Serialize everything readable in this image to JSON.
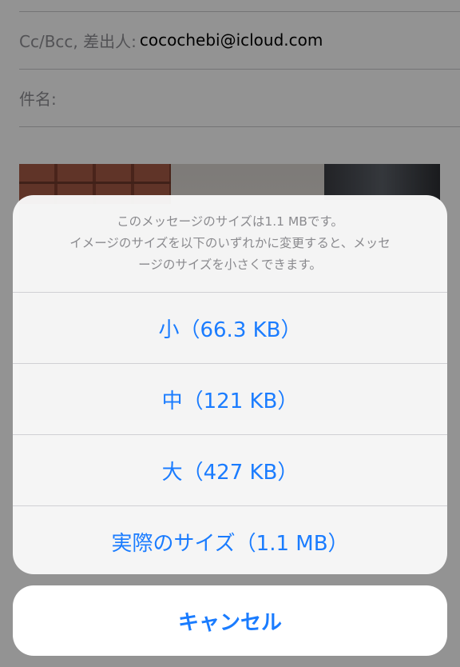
{
  "compose": {
    "cc_bcc_label": "Cc/Bcc, 差出人:",
    "cc_bcc_value": "cocochebi@icloud.com",
    "subject_label": "件名:"
  },
  "action_sheet": {
    "message_lines": [
      "このメッセージのサイズは1.1 MBです。",
      "イメージのサイズを以下のいずれかに変更すると、メッセ",
      "ージのサイズを小さくできます。"
    ],
    "actions": [
      {
        "label": "小（66.3 KB）"
      },
      {
        "label": "中（121 KB）"
      },
      {
        "label": "大（427 KB）"
      },
      {
        "label": "実際のサイズ（1.1 MB）"
      }
    ],
    "cancel_label": "キャンセル"
  },
  "colors": {
    "accent": "#1a7cff",
    "message_text": "#8a8a8e",
    "separator": "#d0d0d4"
  }
}
